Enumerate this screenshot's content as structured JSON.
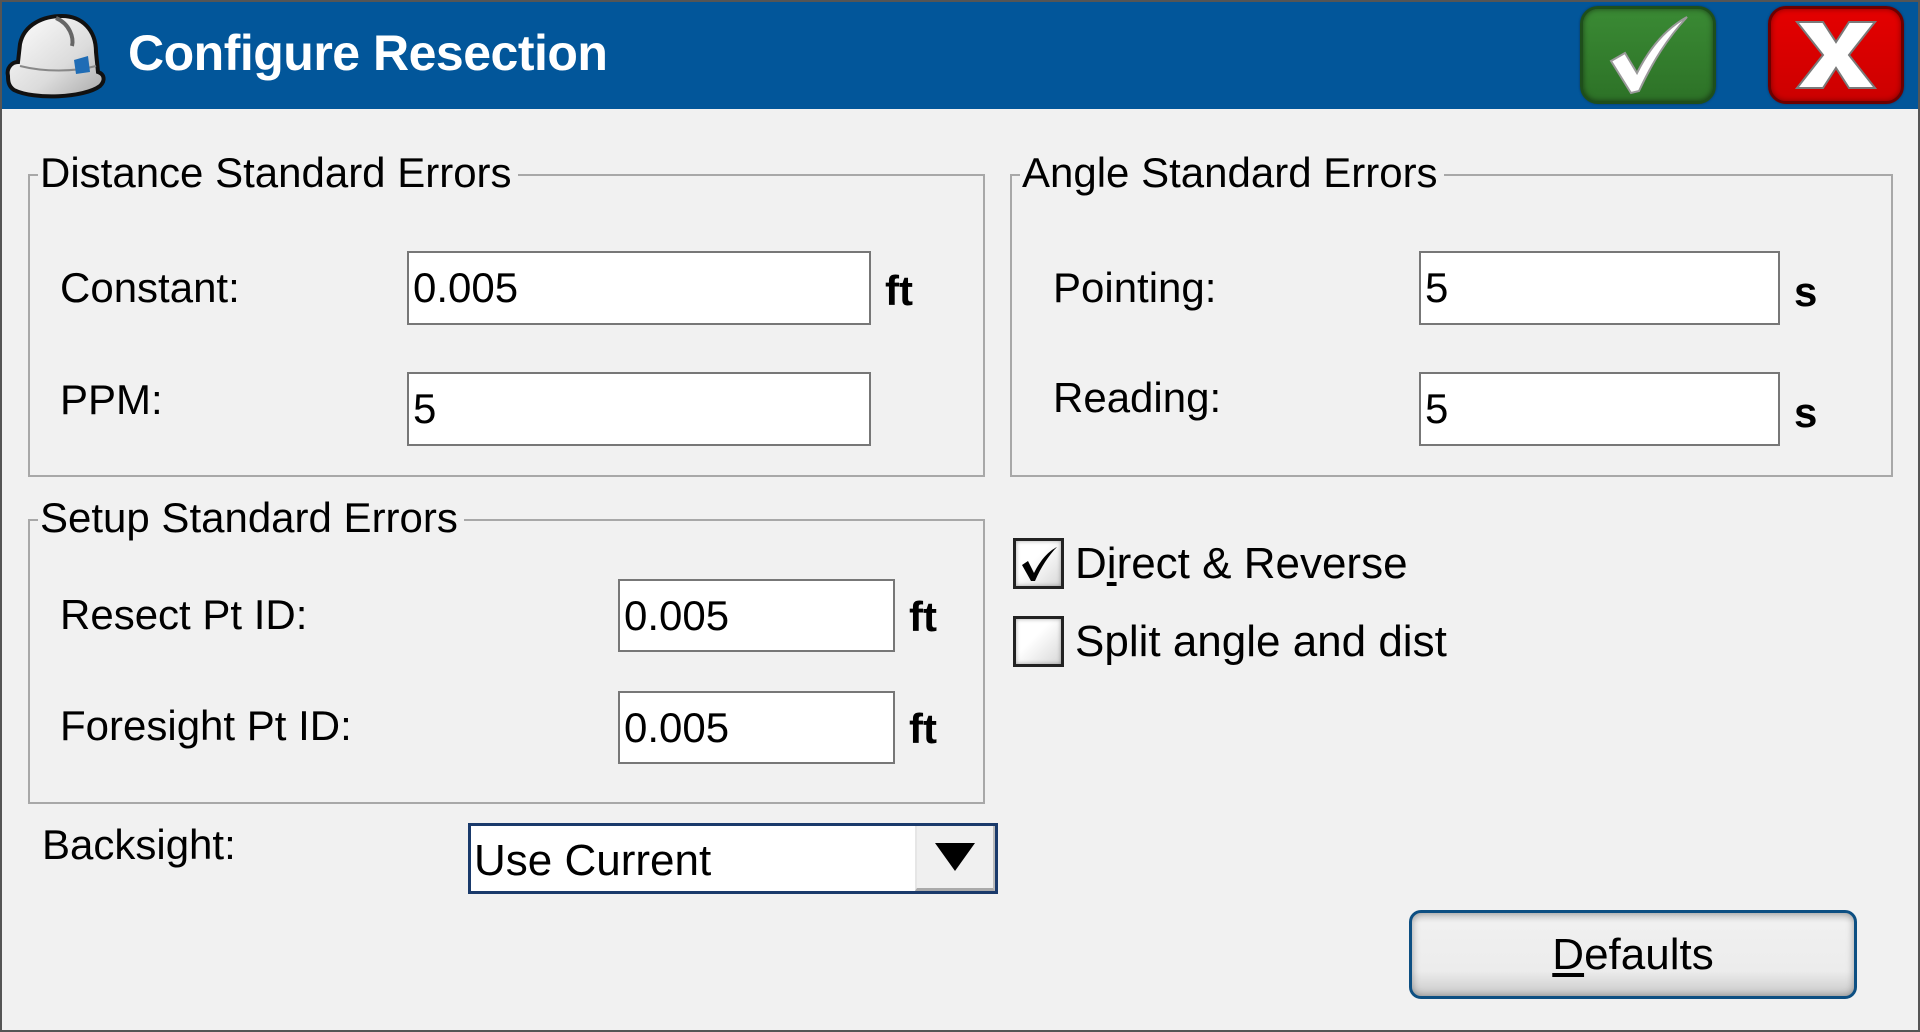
{
  "header": {
    "title": "Configure Resection",
    "app_icon": "hard-hat-icon",
    "ok_icon": "checkmark-icon",
    "cancel_icon": "x-icon",
    "colors": {
      "header_bg": "#02569a",
      "ok": "#2f7a2a",
      "cancel": "#d80000"
    }
  },
  "distance_group": {
    "title": "Distance Standard Errors",
    "constant": {
      "label": "Constant:",
      "value": "0.005",
      "unit": "ft"
    },
    "ppm": {
      "label": "PPM:",
      "value": "5"
    }
  },
  "angle_group": {
    "title": "Angle Standard Errors",
    "pointing": {
      "label": "Pointing:",
      "value": "5",
      "unit": "s"
    },
    "reading": {
      "label": "Reading:",
      "value": "5",
      "unit": "s"
    }
  },
  "setup_group": {
    "title": "Setup Standard Errors",
    "resect": {
      "label": "Resect Pt ID:",
      "value": "0.005",
      "unit": "ft"
    },
    "foresight": {
      "label": "Foresight Pt ID:",
      "value": "0.005",
      "unit": "ft"
    }
  },
  "options": {
    "direct_reverse": {
      "label_pre": "D",
      "label_mnemonic": "i",
      "label_post": "rect & Reverse",
      "checked": true
    },
    "split_angle_dist": {
      "label": "Split angle and dist",
      "checked": false
    }
  },
  "backsight": {
    "label": "Backsight:",
    "selected": "Use Current"
  },
  "defaults_button": {
    "mnemonic": "D",
    "label_rest": "efaults"
  }
}
